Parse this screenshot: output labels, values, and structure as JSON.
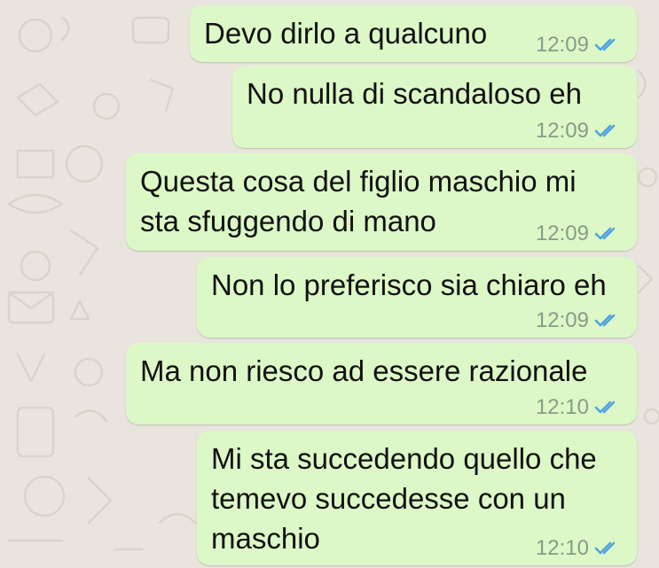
{
  "chat": {
    "messages": [
      {
        "text": "Devo dirlo a qualcuno",
        "time": "12:09",
        "status": "read"
      },
      {
        "text": "No nulla di scandaloso eh",
        "time": "12:09",
        "status": "read"
      },
      {
        "text": "Questa cosa del figlio maschio mi\nsta sfuggendo di mano",
        "time": "12:09",
        "status": "read"
      },
      {
        "text": "Non lo preferisco sia chiaro eh",
        "time": "12:09",
        "status": "read"
      },
      {
        "text": "Ma non riesco ad essere razionale",
        "time": "12:10",
        "status": "read"
      },
      {
        "text": "Mi sta succedendo quello che\ntemevo succedesse con un\nmaschio",
        "time": "12:10",
        "status": "read"
      }
    ]
  },
  "colors": {
    "background": "#e9e5de",
    "outgoing_bubble": "#dcf8c6",
    "read_ticks": "#4fa3e0",
    "timestamp": "#8a9a88"
  },
  "icons": {
    "read_receipt": "double-check-icon"
  }
}
